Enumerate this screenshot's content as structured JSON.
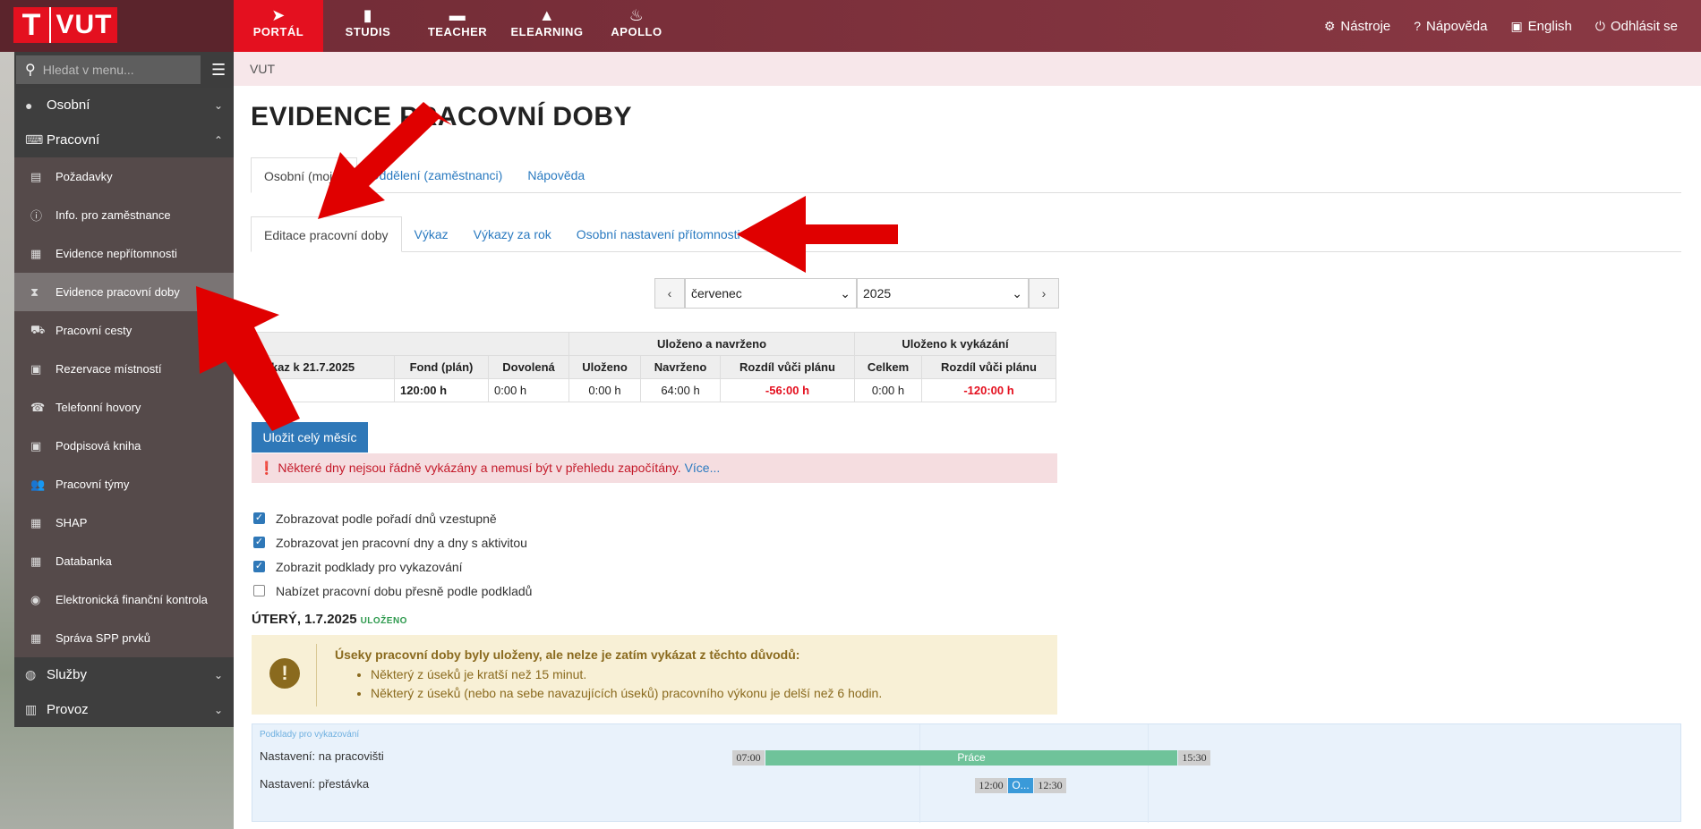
{
  "brand": {
    "logo_t": "T",
    "logo_name": "VUT"
  },
  "topnav": [
    {
      "label": "PORTÁL",
      "icon": "paper-plane-icon"
    },
    {
      "label": "STUDIS",
      "icon": "book-icon"
    },
    {
      "label": "TEACHER",
      "icon": "briefcase-icon"
    },
    {
      "label": "ELEARNING",
      "icon": "graduation-cap-icon"
    },
    {
      "label": "APOLLO",
      "icon": "flame-icon"
    }
  ],
  "topright": [
    {
      "label": "Nástroje",
      "icon": "gear-icon"
    },
    {
      "label": "Nápověda",
      "icon": "question-icon"
    },
    {
      "label": "English",
      "icon": "en-flag-icon"
    },
    {
      "label": "Odhlásit se",
      "icon": "power-icon"
    }
  ],
  "search": {
    "placeholder": "Hledat v menu..."
  },
  "sidebar": {
    "osobni": "Osobní",
    "pracovni": "Pracovní",
    "items": [
      {
        "label": "Požadavky",
        "icon": "ticket-icon"
      },
      {
        "label": "Info. pro zaměstnance",
        "icon": "info-icon"
      },
      {
        "label": "Evidence nepřítomnosti",
        "icon": "grid-icon"
      },
      {
        "label": "Evidence pracovní doby",
        "icon": "hourglass-icon"
      },
      {
        "label": "Pracovní cesty",
        "icon": "car-icon"
      },
      {
        "label": "Rezervace místností",
        "icon": "clipboard-icon"
      },
      {
        "label": "Telefonní hovory",
        "icon": "phone-icon"
      },
      {
        "label": "Podpisová kniha",
        "icon": "clipboard-check-icon"
      },
      {
        "label": "Pracovní týmy",
        "icon": "users-icon"
      },
      {
        "label": "SHAP",
        "icon": "grid-icon"
      },
      {
        "label": "Databanka",
        "icon": "grid-icon"
      },
      {
        "label": "Elektronická finanční kontrola",
        "icon": "eye-icon"
      },
      {
        "label": "Správa SPP prvků",
        "icon": "grid-icon"
      }
    ],
    "sluzby": "Služby",
    "provoz": "Provoz"
  },
  "breadcrumb": "VUT",
  "page_title": "EVIDENCE PRACOVNÍ DOBY",
  "tabs1": [
    "Osobní (moje)",
    "Oddělení (zaměstnanci)",
    "Nápověda"
  ],
  "tabs2": [
    "Editace pracovní doby",
    "Výkaz",
    "Výkazy za rok",
    "Osobní nastavení přítomnosti"
  ],
  "period": {
    "month": "červenec",
    "year": "2025"
  },
  "summary": {
    "group1": "Uloženo a navrženo",
    "group2": "Uloženo k vykázání",
    "headers": [
      "Výkaz k 21.7.2025",
      "Fond (plán)",
      "Dovolená",
      "Uloženo",
      "Navrženo",
      "Rozdíl vůči plánu",
      "Celkem",
      "Rozdíl vůči plánu"
    ],
    "row": [
      "VU",
      "120:00 h",
      "0:00 h",
      "0:00 h",
      "64:00 h",
      "-56:00 h",
      "0:00 h",
      "-120:00 h"
    ]
  },
  "save_button": "Uložit celý měsíc",
  "alert": {
    "text": "Některé dny nejsou řádně vykázány a nemusí být v přehledu započítány.",
    "more": "Více..."
  },
  "options": [
    {
      "label": "Zobrazovat podle pořadí dnů vzestupně",
      "checked": true
    },
    {
      "label": "Zobrazovat jen pracovní dny a dny s aktivitou",
      "checked": true
    },
    {
      "label": "Zobrazit podklady pro vykazování",
      "checked": true
    },
    {
      "label": "Nabízet pracovní dobu přesně podle podkladů",
      "checked": false
    }
  ],
  "day": {
    "title": "ÚTERÝ, 1.7.2025",
    "status": "ULOŽENO"
  },
  "warning": {
    "title": "Úseky pracovní doby byly uloženy, ale nelze je zatím vykázat z těchto důvodů:",
    "items": [
      "Některý z úseků je kratší než 15 minut.",
      "Některý z úseků (nebo na sebe navazujících úseků) pracovního výkonu je delší než 6 hodin."
    ]
  },
  "timeline": {
    "label": "Podklady pro vykazování",
    "rows": [
      {
        "label": "Nastavení: na pracovišti",
        "start": "07:00",
        "end": "15:30",
        "bar": "Práce"
      },
      {
        "label": "Nastavení: přestávka",
        "start": "12:00",
        "end": "12:30",
        "bar": "O..."
      }
    ]
  },
  "colors": {
    "brand_red": "#e4101f",
    "link_blue": "#2a7ac0",
    "header_maroon": "#7a2f3a",
    "arrow_red": "#e00000"
  }
}
